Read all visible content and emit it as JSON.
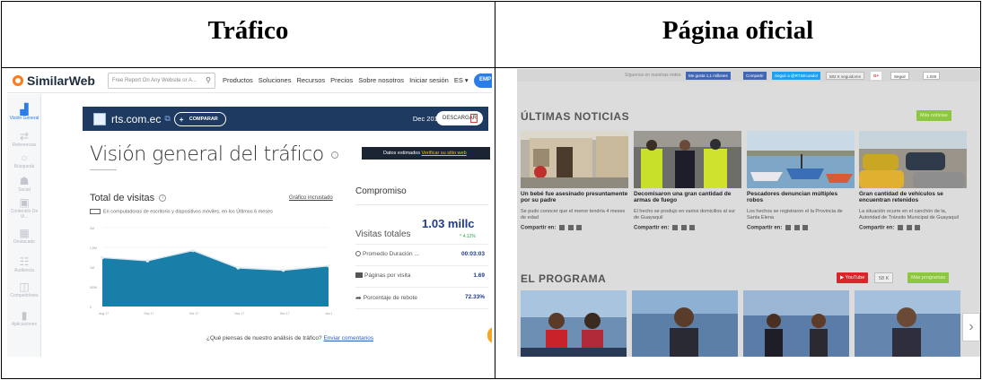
{
  "table": {
    "col_left_title": "Tráfico",
    "col_right_title": "Página oficial"
  },
  "similarweb": {
    "logo": "SimilarWeb",
    "search_placeholder": "Free Report On Any Website or A...",
    "nav": [
      "Productos",
      "Soluciones",
      "Recursos",
      "Precios",
      "Sobre nosotros",
      "Iniciar sesión",
      "ES ▾"
    ],
    "emp_button": "EMP",
    "sidebar": [
      {
        "label": "Visión General",
        "icon": "chart-icon",
        "active": true
      },
      {
        "label": "Referencias",
        "icon": "referrals-icon"
      },
      {
        "label": "Búsqueda",
        "icon": "search-icon"
      },
      {
        "label": "Social",
        "icon": "social-icon"
      },
      {
        "label": "Contenido De Vi...",
        "icon": "display-icon"
      },
      {
        "label": "Destacado",
        "icon": "featured-icon"
      },
      {
        "label": "Audiencia",
        "icon": "audience-icon"
      },
      {
        "label": "Competidores",
        "icon": "competitors-icon"
      },
      {
        "label": "Aplicaciones",
        "icon": "apps-icon"
      }
    ],
    "banner": {
      "site": "rts.com.ec",
      "compare": "COMPARAR",
      "date": "Dec 2017",
      "download": "DESCARGAR"
    },
    "overview_title": "Visión general del tráfico",
    "estimated": {
      "text": "Datos estimados",
      "link": "Verificar su sitio web"
    },
    "total_visits": {
      "title": "Total de visitas",
      "embedded_link": "Gráfico incrustado",
      "subtitle": "En computadoras de escritorio y dispositivos móviles, en los Últimos 6 meses"
    },
    "engagement": {
      "title": "Compromiso",
      "total_label": "Visitas totales",
      "total_value": "1.03 millc",
      "trend": "^ 4.12%",
      "metrics": [
        {
          "label": "Promedio Duración ...",
          "value": "00:03:03",
          "icon": "clock-icon"
        },
        {
          "label": "Páginas por visita",
          "value": "1.69",
          "icon": "pages-icon"
        },
        {
          "label": "Porcentaje de rebote",
          "value": "72.33%",
          "icon": "bounce-arrow-icon"
        }
      ]
    },
    "feedback": {
      "text": "¿Qué piensas de nuestro análisis de tráfico?",
      "link": "Enviar comentarios"
    }
  },
  "chart_data": {
    "type": "area",
    "x": [
      "Ago 17",
      "Sep 17",
      "Oct 17",
      "Nov 17",
      "Dic 17",
      "Ene 18"
    ],
    "xticks": [
      "Aug 17",
      "Sep 17",
      "Oct 17",
      "Nov 17",
      "Dec 17",
      "Jan 18"
    ],
    "yticks": [
      "2M",
      "1.5M",
      "1M",
      "500K",
      "0"
    ],
    "values": [
      1.24,
      1.16,
      1.42,
      0.98,
      0.92,
      1.03
    ],
    "ylim": [
      0,
      2.0
    ],
    "color": "#1a7fa8"
  },
  "news": {
    "social": {
      "label": "Síguenos en nuestras redes",
      "like": "Me gusta 1,1 millones",
      "share": "Compartir",
      "follow": "Seguir a @RTSEcuador",
      "followers": "582 K seguidores",
      "gplus": "Seguir",
      "gcount": "1.589"
    },
    "latest_title": "ÚLTIMAS NOTICIAS",
    "more_news": "Más noticias",
    "cards": [
      {
        "head": "Un bebé fue asesinado presuntamente por su padre",
        "body": "Se pudo conocer que el menor tendría 4 meses de edad",
        "img": "house"
      },
      {
        "head": "Decomisaron una gran cantidad de armas de fuego",
        "body": "El hecho se produjo en varios domicilios al sur de Guayaquil",
        "img": "police"
      },
      {
        "head": "Pescadores denuncian múltiples robos",
        "body": "Los hechos se registraron el la Provincia de Santa Elena",
        "img": "boats"
      },
      {
        "head": "Gran cantidad de vehículos se encuentran retenidos",
        "body": "La situación ocurre en el canchón de la, Autoridad de Tránsito Municipal de Guayaquil",
        "img": "cars"
      }
    ],
    "share_label": "Compartir en:",
    "program_title": "EL PROGRAMA",
    "youtube": "YouTube",
    "youtube_count": "58 K",
    "more_programs": "Más programas",
    "next": "›"
  }
}
